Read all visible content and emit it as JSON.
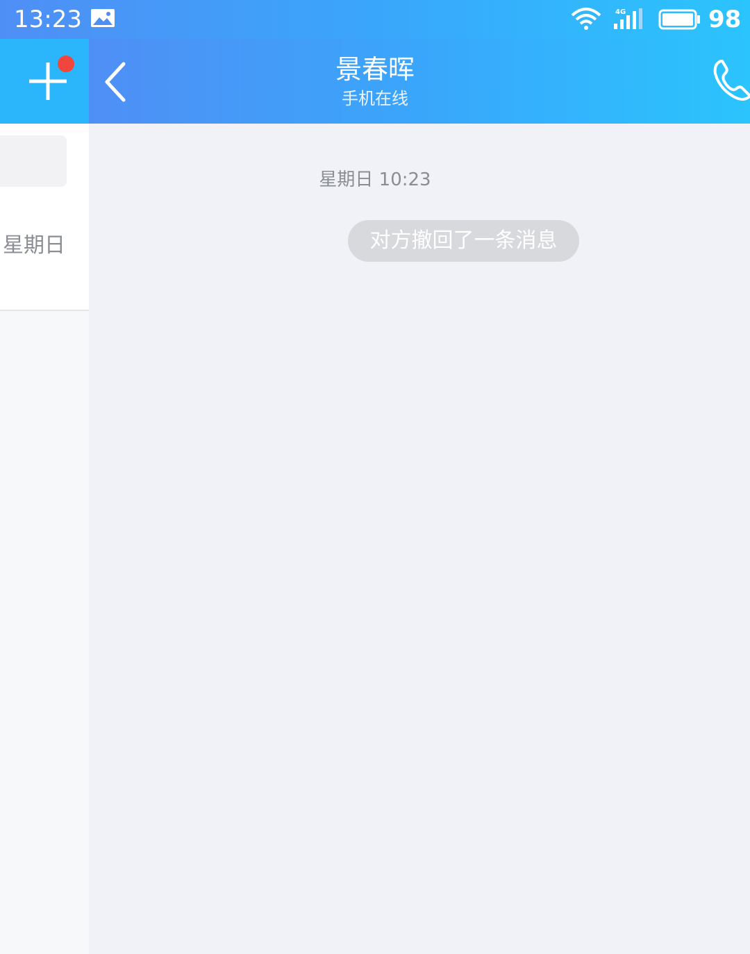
{
  "status_bar": {
    "time": "13:23",
    "battery_level": "98",
    "icons": [
      "gallery-icon",
      "wifi-icon",
      "signal-4g-icon",
      "battery-icon"
    ]
  },
  "sidebar": {
    "add_icon": "plus-icon",
    "notification_dot_color": "#f2453d",
    "list_item_date": "星期日"
  },
  "chat_header": {
    "contact_name": "景春晖",
    "contact_status": "手机在线",
    "back_icon": "chevron-left-icon",
    "call_icon": "phone-icon"
  },
  "chat": {
    "timestamp": "星期日 10:23",
    "system_message": "对方撤回了一条消息"
  },
  "colors": {
    "header_gradient_start": "#4f8ff5",
    "header_gradient_end": "#2bc4fd",
    "chat_background": "#f0f2f7"
  }
}
